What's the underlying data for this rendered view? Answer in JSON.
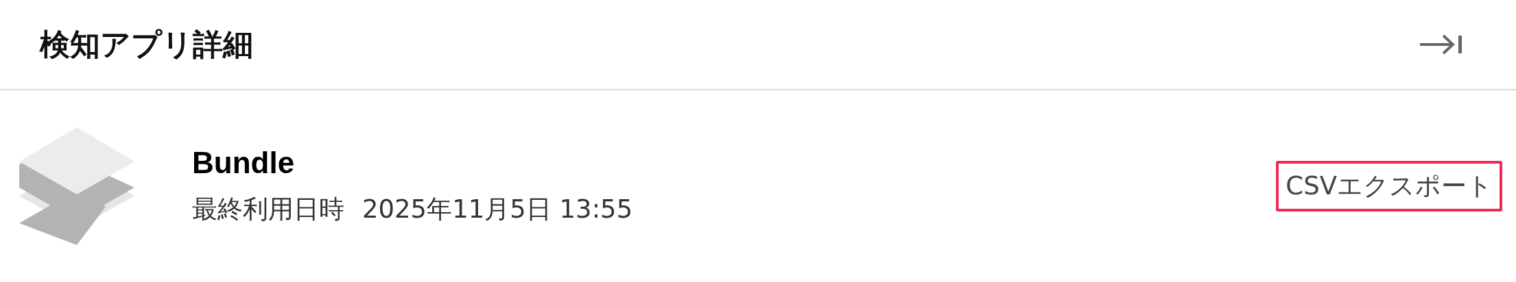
{
  "header": {
    "title": "検知アプリ詳細"
  },
  "app": {
    "name": "Bundle",
    "last_used_label": "最終利用日時",
    "last_used_value": "2025年11月5日 13:55"
  },
  "actions": [
    {
      "label": "CSVエクスポート"
    }
  ]
}
